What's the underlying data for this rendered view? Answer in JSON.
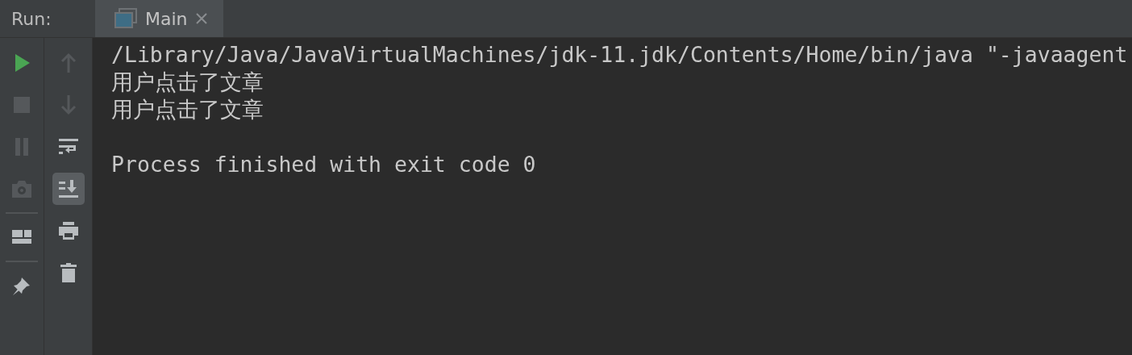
{
  "header": {
    "label": "Run:",
    "tabs": [
      {
        "label": "Main",
        "selected": true
      }
    ]
  },
  "toolbar_left": [
    {
      "kind": "run",
      "disabled": false
    },
    {
      "kind": "stop",
      "disabled": true
    },
    {
      "kind": "pause",
      "disabled": true
    },
    {
      "kind": "camera",
      "disabled": true
    },
    {
      "kind": "separator"
    },
    {
      "kind": "layout",
      "disabled": false
    },
    {
      "kind": "separator"
    },
    {
      "kind": "pin",
      "disabled": false
    }
  ],
  "toolbar_right": [
    {
      "kind": "up",
      "disabled": true,
      "selected": false
    },
    {
      "kind": "down",
      "disabled": true,
      "selected": false
    },
    {
      "kind": "wrap",
      "disabled": false,
      "selected": false
    },
    {
      "kind": "scroll-end",
      "disabled": false,
      "selected": true
    },
    {
      "kind": "print",
      "disabled": false,
      "selected": false
    },
    {
      "kind": "delete",
      "disabled": false,
      "selected": false
    }
  ],
  "console": {
    "lines": [
      "/Library/Java/JavaVirtualMachines/jdk-11.jdk/Contents/Home/bin/java \"-javaagent",
      "用户点击了文章",
      "用户点击了文章"
    ],
    "exit_message": "Process finished with exit code 0"
  }
}
